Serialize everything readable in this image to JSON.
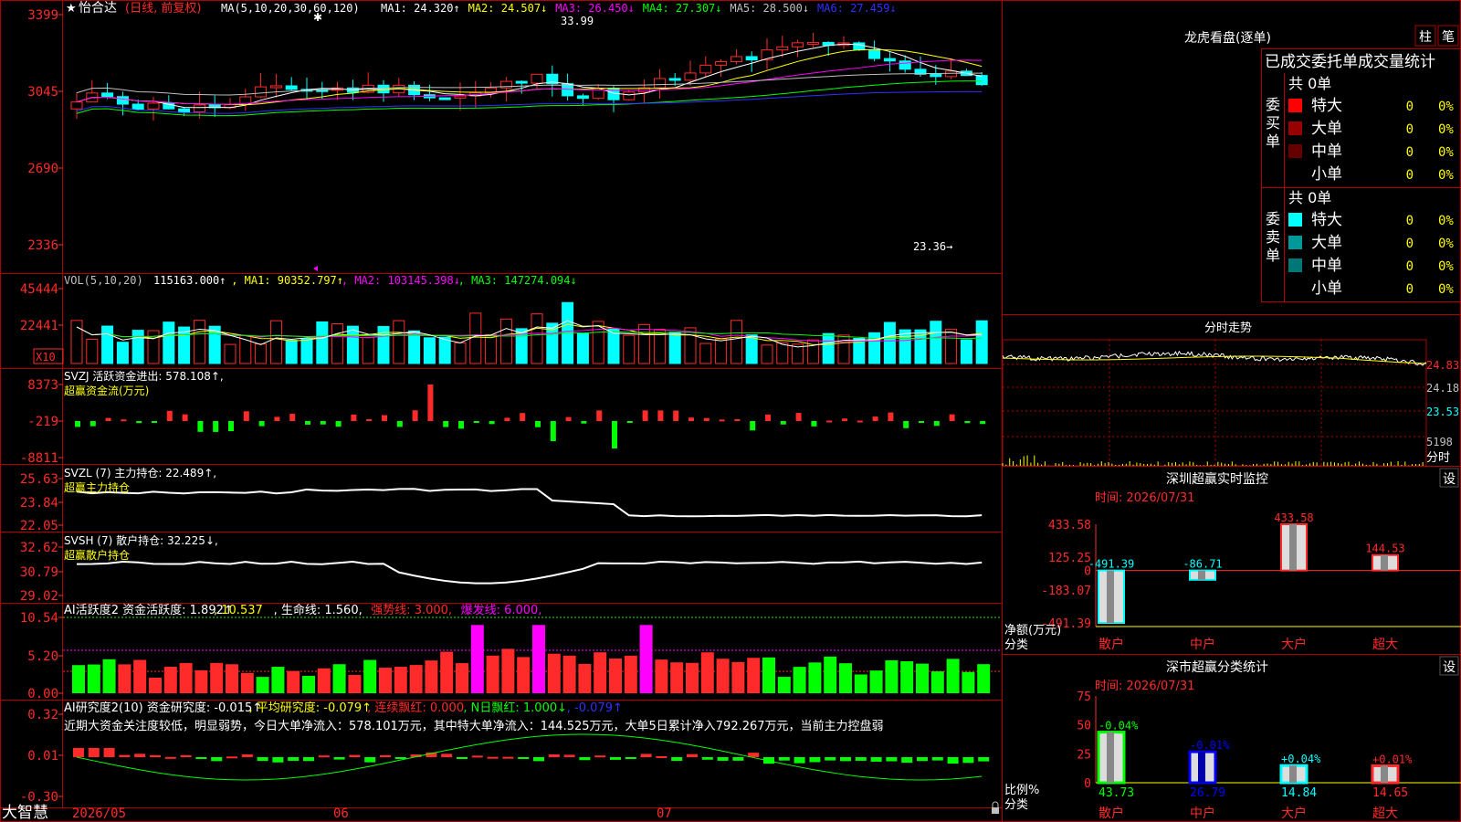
{
  "colors": {
    "up": "#ff2a2a",
    "down": "#00ffff",
    "ma1": "#ffffff",
    "ma2": "#ffff00",
    "ma3": "#ff00ff",
    "ma4": "#00ff00",
    "ma5": "#c0c0c0",
    "ma6": "#3030ff",
    "frame": "#b00000",
    "yellow": "#ffff00",
    "green": "#00ff00",
    "cyan": "#00ffff",
    "magenta": "#ff00ff",
    "white": "#ffffff"
  },
  "kline": {
    "star": "★",
    "stock": "怡合达",
    "mode": "(日线, 前复权)",
    "ma_params": "MA(5,10,20,30,60,120)",
    "ma_values": [
      {
        "label": "MA1: 24.320↑",
        "color": "#ffffff"
      },
      {
        "label": "MA2: 24.507↓",
        "color": "#ffff00"
      },
      {
        "label": "MA3: 26.450↓",
        "color": "#ff00ff"
      },
      {
        "label": "MA4: 27.307↓",
        "color": "#00ff00"
      },
      {
        "label": "MA5: 28.500↓",
        "color": "#c0c0c0"
      },
      {
        "label": "MA6: 27.459↓",
        "color": "#3030ff"
      }
    ],
    "y_ticks": [
      "3399",
      "3045",
      "2690",
      "2336"
    ],
    "high_label": "33.99",
    "low_label": "23.36→"
  },
  "vol": {
    "header": "VOL(5,10,20)",
    "values": [
      {
        "label": " 115163.000↑",
        "color": "#ffffff"
      },
      {
        "label": ", MA1: 90352.797↑",
        "color": "#ffff00"
      },
      {
        "label": ", MA2: 103145.398↓",
        "color": "#ff00ff"
      },
      {
        "label": ", MA3: 147274.094↓",
        "color": "#00ff00"
      }
    ],
    "y_ticks": [
      "45444",
      "22441"
    ],
    "unit": "X10"
  },
  "svzj": {
    "title": "SVZJ  活跃资金进出: 578.108↑,",
    "sub": "超赢资金流(万元)",
    "y_ticks": [
      "8373",
      "-219",
      "-8811"
    ]
  },
  "svzl": {
    "title": "SVZL (7) 主力持仓: 22.489↑,",
    "sub": "超赢主力持仓",
    "y_ticks": [
      "25.63",
      "23.84",
      "22.05"
    ]
  },
  "svsh": {
    "title": "SVSH (7) 散户持仓: 32.225↓,",
    "sub": "超赢散户持仓",
    "y_ticks": [
      "32.62",
      "30.79",
      "29.02"
    ]
  },
  "ai2": {
    "parts": [
      {
        "label": "AI活跃度2 资金活跃度: 1.892↑",
        "color": "#ffffff"
      },
      {
        "label": ", 10.537",
        "color": "#ffff00"
      },
      {
        "label": ", 生命线: 1.560,",
        "color": "#ffffff"
      },
      {
        "label": " 强势线: 3.000,",
        "color": "#ff2a2a"
      },
      {
        "label": " 爆发线: 6.000,",
        "color": "#ff00ff"
      }
    ],
    "y_ticks": [
      "10.54",
      "5.20",
      "0.00"
    ]
  },
  "ai_research": {
    "parts": [
      {
        "label": "AI研究度2(10) 资金研究度: -0.015↑",
        "color": "#ffffff"
      },
      {
        "label": ", 平均研究度: -0.079↑",
        "color": "#ffff00"
      },
      {
        "label": ", 连续飘红: 0.000",
        "color": "#ff2a2a"
      },
      {
        "label": ", N日飘红: 1.000↓",
        "color": "#00ff00"
      },
      {
        "label": ", -0.079↑",
        "color": "#3030ff"
      }
    ],
    "comment": "近期大资金关注度较低，明显弱势，今日大单净流入：578.101万元，其中特大单净流入：144.525万元，大单5日累计净入792.267万元，当前主力控盘弱",
    "y_ticks": [
      "0.32",
      "0.01",
      "-0.30"
    ]
  },
  "footer": {
    "logo": "大智慧",
    "dates": [
      "2026/05",
      "06",
      "07"
    ]
  },
  "dragon": {
    "title": "龙虎看盘(逐单)",
    "btn_col": "柱",
    "btn_pen": "笔",
    "tabs": "已成交委托单成交量统计",
    "buy_label": "委买单",
    "sell_label": "委卖单",
    "buy_total": "共 0单",
    "sell_total": "共 0单",
    "buy_rows": [
      {
        "name": "特大",
        "count": "0",
        "pct": "0%",
        "color": "#ff0000"
      },
      {
        "name": "大单",
        "count": "0",
        "pct": "0%",
        "color": "#990000"
      },
      {
        "name": "中单",
        "count": "0",
        "pct": "0%",
        "color": "#660000"
      },
      {
        "name": "小单",
        "count": "0",
        "pct": "0%",
        "color": "#000000"
      }
    ],
    "sell_rows": [
      {
        "name": "特大",
        "count": "0",
        "pct": "0%",
        "color": "#00ffff"
      },
      {
        "name": "大单",
        "count": "0",
        "pct": "0%",
        "color": "#009999"
      },
      {
        "name": "中单",
        "count": "0",
        "pct": "0%",
        "color": "#007777"
      },
      {
        "name": "小单",
        "count": "0",
        "pct": "0%",
        "color": "#000000"
      }
    ]
  },
  "intraday": {
    "title": "分时走势",
    "y_ticks": [
      "24.83",
      "24.18",
      "23.53"
    ],
    "vol_tick": "5198",
    "label": "分时"
  },
  "monitor": {
    "title": "深圳超赢实时监控",
    "set": "设",
    "date": "时间: 2026/07/31",
    "y_ticks": [
      "433.58",
      "125.25",
      "0",
      "-183.07",
      "-491.39"
    ],
    "axis_label_1": "净额(万元)",
    "axis_label_2": "分类",
    "chart_data": {
      "type": "bar",
      "categories": [
        "散户",
        "中户",
        "大户",
        "超大"
      ],
      "values": [
        -491.39,
        -86.71,
        433.58,
        144.53
      ],
      "value_labels": [
        "-491.39",
        "-86.71",
        "433.58",
        "144.53"
      ],
      "ylim": [
        -491.39,
        433.58
      ],
      "ylabel": "净额(万元)",
      "xlabel": "分类"
    }
  },
  "classify": {
    "title": "深市超赢分类统计",
    "set": "设",
    "date": "时间: 2026/07/31",
    "y_ticks": [
      "75",
      "50",
      "25",
      "0"
    ],
    "axis_label_1": "比例%",
    "axis_label_2": "分类",
    "chart_data": {
      "type": "bar",
      "categories": [
        "散户",
        "中户",
        "大户",
        "超大"
      ],
      "values": [
        43.73,
        26.79,
        14.84,
        14.65
      ],
      "changes": [
        "-0.04%",
        "-0.01%",
        "+0.04%",
        "+0.01%"
      ],
      "value_labels": [
        "43.73",
        "26.79",
        "14.84",
        "14.65"
      ],
      "ylim": [
        0,
        75
      ],
      "ylabel": "比例%",
      "xlabel": "分类"
    }
  }
}
